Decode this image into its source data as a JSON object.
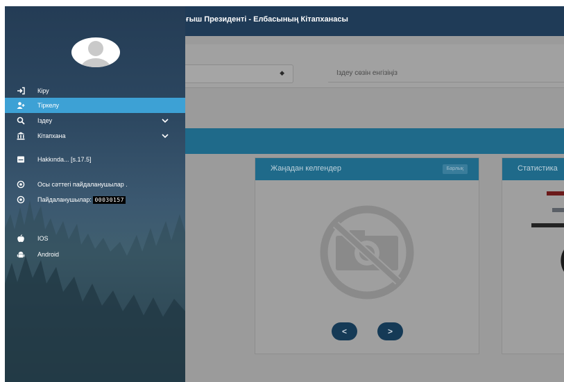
{
  "header": {
    "title": "ғыш Президенті - Елбасының Кітапханасы"
  },
  "search": {
    "placeholder": "Іздеу сөзін енгізіңіз"
  },
  "cards": {
    "new_arrivals": {
      "title": "Жаңадан келгендер",
      "badge": "Барлық"
    },
    "statistics": {
      "title": "Статистика"
    }
  },
  "carousel": {
    "prev_label": "<",
    "next_label": ">"
  },
  "sidebar": {
    "items": [
      {
        "label": "Кіру",
        "icon": "login-icon"
      },
      {
        "label": "Тіркелу",
        "icon": "add-user-icon",
        "active": true
      },
      {
        "label": "Іздеу",
        "icon": "search-icon",
        "expandable": true
      },
      {
        "label": "Кітапхана",
        "icon": "library-icon",
        "expandable": true
      },
      {
        "label": "Hakkında... [s.17.5]",
        "icon": "card-icon"
      },
      {
        "label": "Осы сәттегі пайдаланушылар .",
        "icon": "target-icon"
      },
      {
        "label": "Пайдаланушылар:",
        "icon": "target-icon",
        "counter": "00030157"
      },
      {
        "label": "IOS",
        "icon": "apple-icon"
      },
      {
        "label": "Android",
        "icon": "android-icon"
      }
    ]
  },
  "colors": {
    "sidebar_active": "#3da1d5",
    "header": "#1f3b57",
    "card_header": "#1f6a8a"
  }
}
